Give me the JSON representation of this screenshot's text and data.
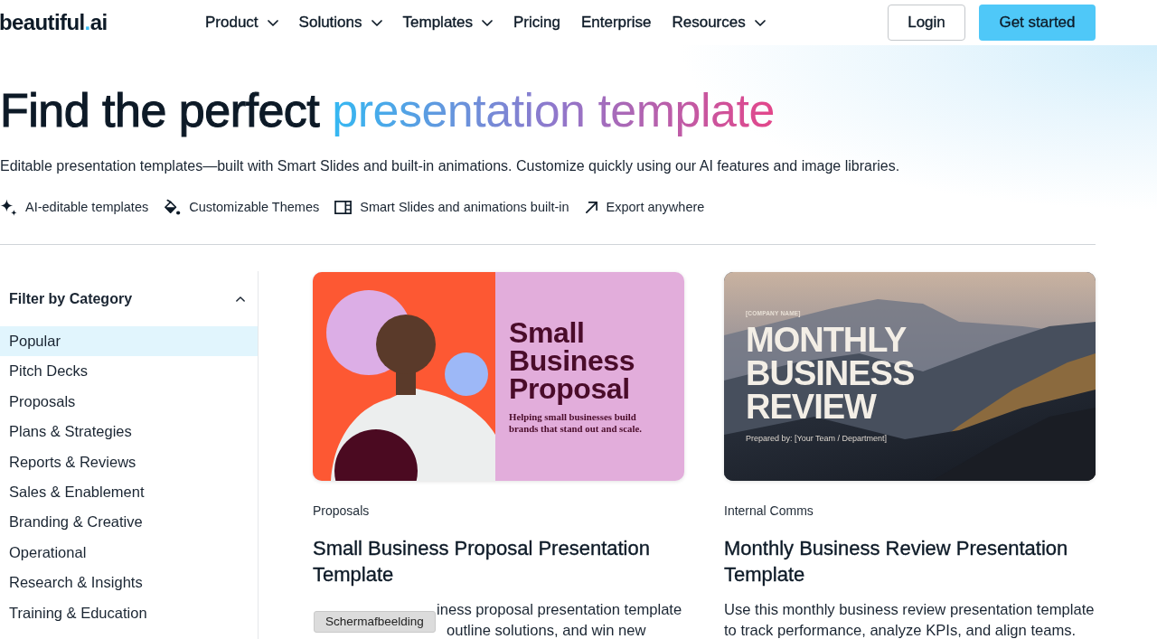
{
  "nav": {
    "logo": {
      "name": "beautiful",
      "dot": ".",
      "suffix": "ai"
    },
    "items": [
      {
        "label": "Product",
        "dropdown": true
      },
      {
        "label": "Solutions",
        "dropdown": true
      },
      {
        "label": "Templates",
        "dropdown": true
      },
      {
        "label": "Pricing",
        "dropdown": false
      },
      {
        "label": "Enterprise",
        "dropdown": false
      },
      {
        "label": "Resources",
        "dropdown": true
      }
    ],
    "buttons": [
      {
        "label": "Login",
        "kind": "outline"
      },
      {
        "label": "Get started",
        "kind": "primary"
      }
    ]
  },
  "hero": {
    "title": "Find the perfect",
    "title_highlight": "presentation template",
    "subtitle": "Editable presentation templates—built with Smart Slides and built-in animations. Customize quickly using our AI features and image libraries.",
    "features": [
      "AI-editable templates",
      "Customizable Themes",
      "Smart Slides and animations built-in",
      "Export anywhere"
    ]
  },
  "sidebar": {
    "heading": "Filter by Category",
    "expanded": true,
    "items": [
      {
        "label": "Popular",
        "selected": true
      },
      {
        "label": "Pitch Decks",
        "selected": false
      },
      {
        "label": "Proposals",
        "selected": false
      },
      {
        "label": "Plans & Strategies",
        "selected": false
      },
      {
        "label": "Reports & Reviews",
        "selected": false
      },
      {
        "label": "Sales & Enablement",
        "selected": false
      },
      {
        "label": "Branding & Creative",
        "selected": false
      },
      {
        "label": "Operational",
        "selected": false
      },
      {
        "label": "Research & Insights",
        "selected": false
      },
      {
        "label": "Training & Education",
        "selected": false
      }
    ]
  },
  "templates": [
    {
      "category": "Proposals",
      "title": "Small Business Proposal Presentation Template",
      "description_visible": [
        "iness proposal presentation template",
        "outline solutions, and win new"
      ],
      "slide": {
        "kind": "split",
        "heading": "Small Business Proposal",
        "tagline": "Helping small businesses build brands that stand out and scale."
      }
    },
    {
      "category": "Internal Comms",
      "title": "Monthly Business Review Presentation Template",
      "description": "Use this monthly business review presentation template to track performance, analyze KPIs, and align teams.",
      "slide": {
        "kind": "photo",
        "eyebrow": "[COMPANY NAME]",
        "heading": "MONTHLY BUSINESS REVIEW",
        "byline": "Prepared by: [Your Team / Department]"
      }
    }
  ],
  "overlay": {
    "label": "Schermafbeelding"
  }
}
